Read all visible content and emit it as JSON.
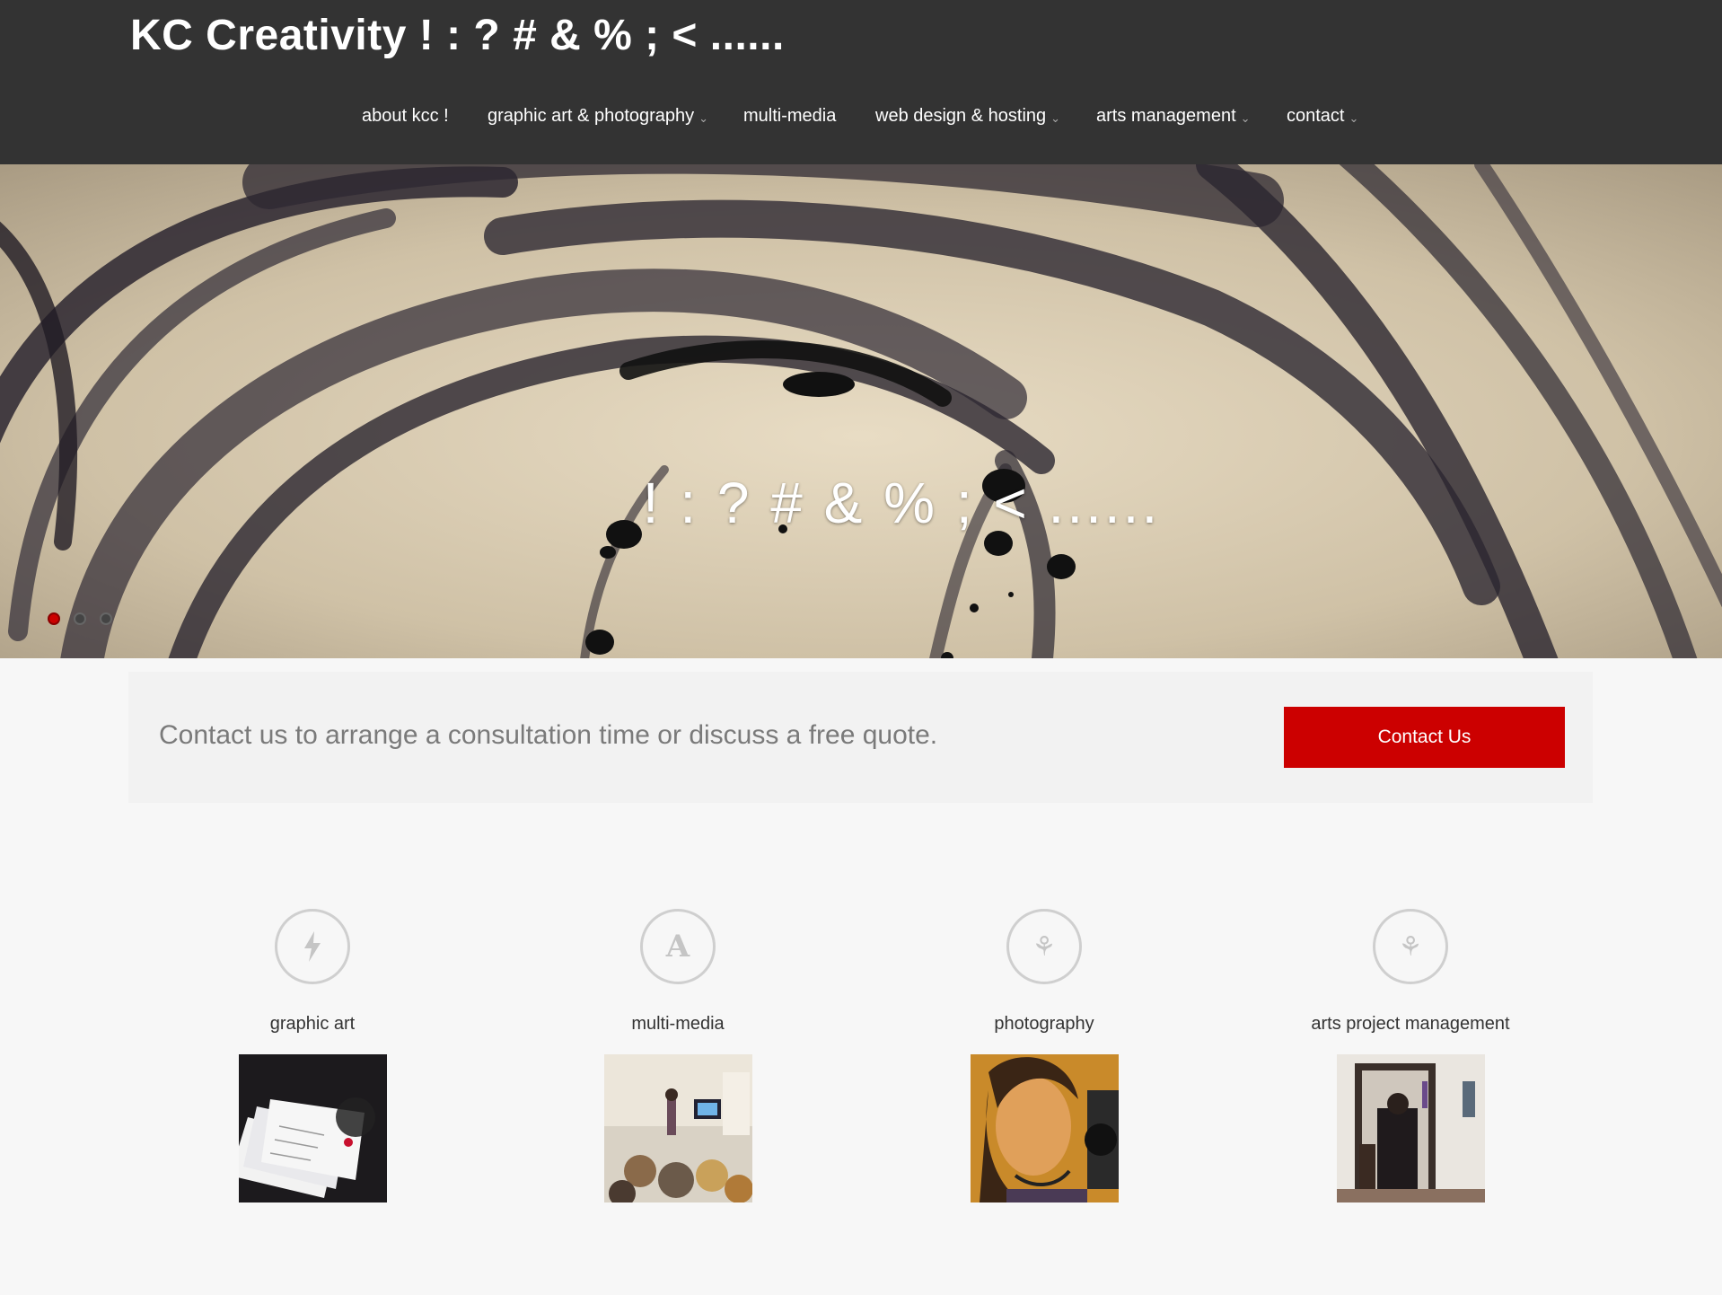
{
  "header": {
    "site_title": "KC Creativity ! : ? # & % ; < ......",
    "nav": [
      {
        "label": "about kcc !",
        "has_dropdown": false
      },
      {
        "label": "graphic art & photography",
        "has_dropdown": true
      },
      {
        "label": "multi-media",
        "has_dropdown": false
      },
      {
        "label": "web design & hosting",
        "has_dropdown": true
      },
      {
        "label": "arts management",
        "has_dropdown": true
      },
      {
        "label": "contact",
        "has_dropdown": true
      }
    ],
    "dropdown_glyph": "⌄"
  },
  "hero": {
    "caption": "! : ? # & % ; < ......",
    "slides_total": 3,
    "active_slide": 1
  },
  "cta": {
    "text": "Contact us to arrange a consultation time or discuss a free quote.",
    "button_label": "Contact Us"
  },
  "services": [
    {
      "title": "graphic art",
      "icon": "lightning-icon",
      "glyph": "ϟ"
    },
    {
      "title": "multi-media",
      "icon": "letter-a-icon",
      "glyph": "A"
    },
    {
      "title": "photography",
      "icon": "leaf-icon",
      "glyph": "⚘"
    },
    {
      "title": "arts project management",
      "icon": "leaf-icon",
      "glyph": "⚘"
    }
  ],
  "colors": {
    "header_bg": "#333333",
    "accent_red": "#cc0000",
    "page_bg": "#f7f7f7",
    "cta_bg": "#f2f2f2"
  }
}
